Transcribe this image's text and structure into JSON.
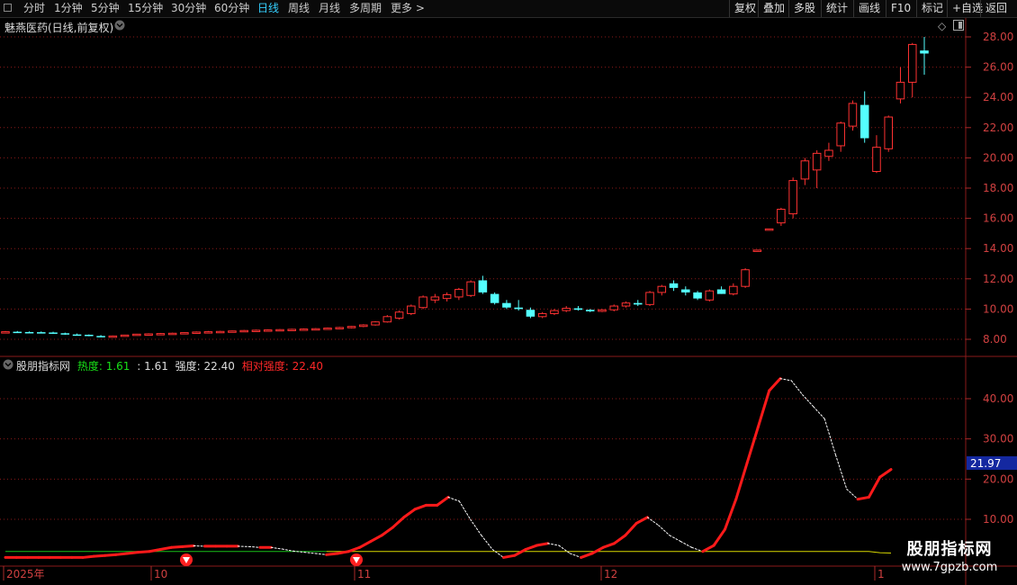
{
  "toolbar": {
    "left_items": [
      {
        "label": "分时",
        "active": false
      },
      {
        "label": "1分钟",
        "active": false
      },
      {
        "label": "5分钟",
        "active": false
      },
      {
        "label": "15分钟",
        "active": false
      },
      {
        "label": "30分钟",
        "active": false
      },
      {
        "label": "60分钟",
        "active": false
      },
      {
        "label": "日线",
        "active": true
      },
      {
        "label": "周线",
        "active": false
      },
      {
        "label": "月线",
        "active": false
      },
      {
        "label": "多周期",
        "active": false
      },
      {
        "label": "更多 >",
        "active": false
      }
    ],
    "right_items": [
      "复权",
      "叠加",
      "多股",
      "统计",
      "画线",
      "F10",
      "标记",
      "+自选",
      "返回"
    ]
  },
  "main_chart": {
    "title": "魅燕医药(日线,前复权)",
    "axis_ticks": [
      "28.00",
      "26.00",
      "24.00",
      "22.00",
      "20.00",
      "18.00",
      "16.00",
      "14.00",
      "12.00",
      "10.00",
      "8.00"
    ]
  },
  "indicator": {
    "name": "股朋指标网",
    "heat_label": "热度:",
    "heat_value": "1.61",
    "sep_value": ": 1.61",
    "strength_label": "强度:",
    "strength_value": "22.40",
    "rel_strength_label": "相对强度:",
    "rel_strength_value": "22.40",
    "axis_ticks": [
      "40.00",
      "30.00",
      "20.00",
      "10.00"
    ],
    "current_value": "21.97"
  },
  "date_axis": [
    "2025年",
    "10",
    "11",
    "12",
    "1"
  ],
  "watermark": {
    "name": "股朋指标网",
    "url": "www.7gpzb.com"
  },
  "colors": {
    "up": "#ff3232",
    "down": "#54ffff",
    "line_red": "#ff1a1a",
    "line_white": "#ffffff",
    "line_green": "#18c018",
    "line_yellow": "#d8d800",
    "grid": "#8a1a1a",
    "active_tab": "#35d0ff"
  },
  "chart_data": [
    {
      "type": "candlestick",
      "title": "魅燕医药(日线,前复权)",
      "ylim": [
        7,
        29
      ],
      "series": [
        {
          "name": "candles",
          "ohlc": [
            [
              8.5,
              8.55,
              8.45,
              8.5
            ],
            [
              8.5,
              8.55,
              8.45,
              8.48
            ],
            [
              8.48,
              8.52,
              8.44,
              8.47
            ],
            [
              8.47,
              8.52,
              8.42,
              8.45
            ],
            [
              8.45,
              8.5,
              8.38,
              8.4
            ],
            [
              8.4,
              8.44,
              8.3,
              8.32
            ],
            [
              8.32,
              8.38,
              8.25,
              8.3
            ],
            [
              8.3,
              8.32,
              8.2,
              8.22
            ],
            [
              8.22,
              8.28,
              8.16,
              8.18
            ],
            [
              8.18,
              8.25,
              8.15,
              8.22
            ],
            [
              8.22,
              8.3,
              8.2,
              8.28
            ],
            [
              8.28,
              8.36,
              8.24,
              8.34
            ],
            [
              8.34,
              8.4,
              8.28,
              8.36
            ],
            [
              8.36,
              8.42,
              8.3,
              8.38
            ],
            [
              8.38,
              8.44,
              8.32,
              8.4
            ],
            [
              8.4,
              8.46,
              8.36,
              8.44
            ],
            [
              8.44,
              8.52,
              8.4,
              8.48
            ],
            [
              8.48,
              8.55,
              8.42,
              8.5
            ],
            [
              8.5,
              8.56,
              8.44,
              8.52
            ],
            [
              8.52,
              8.58,
              8.46,
              8.55
            ],
            [
              8.55,
              8.62,
              8.5,
              8.58
            ],
            [
              8.58,
              8.64,
              8.52,
              8.6
            ],
            [
              8.6,
              8.66,
              8.54,
              8.62
            ],
            [
              8.62,
              8.68,
              8.56,
              8.64
            ],
            [
              8.64,
              8.7,
              8.58,
              8.66
            ],
            [
              8.66,
              8.72,
              8.6,
              8.68
            ],
            [
              8.68,
              8.74,
              8.62,
              8.7
            ],
            [
              8.7,
              8.78,
              8.64,
              8.74
            ],
            [
              8.74,
              8.82,
              8.68,
              8.78
            ],
            [
              8.78,
              8.88,
              8.72,
              8.85
            ],
            [
              8.85,
              9.0,
              8.8,
              8.95
            ],
            [
              8.95,
              9.2,
              8.9,
              9.15
            ],
            [
              9.15,
              9.6,
              9.1,
              9.5
            ],
            [
              9.4,
              9.9,
              9.3,
              9.8
            ],
            [
              9.7,
              10.3,
              9.6,
              10.2
            ],
            [
              10.1,
              10.9,
              10.0,
              10.8
            ],
            [
              10.6,
              11.0,
              10.4,
              10.8
            ],
            [
              10.7,
              11.1,
              10.5,
              10.95
            ],
            [
              10.8,
              11.4,
              10.6,
              11.3
            ],
            [
              10.9,
              11.9,
              10.8,
              11.8
            ],
            [
              11.9,
              12.2,
              11.0,
              11.1
            ],
            [
              11.0,
              11.1,
              10.3,
              10.4
            ],
            [
              10.4,
              10.6,
              10.0,
              10.1
            ],
            [
              10.1,
              10.6,
              9.9,
              10.0
            ],
            [
              9.95,
              10.1,
              9.4,
              9.5
            ],
            [
              9.5,
              9.8,
              9.4,
              9.7
            ],
            [
              9.7,
              10.0,
              9.6,
              9.9
            ],
            [
              9.9,
              10.2,
              9.8,
              10.05
            ],
            [
              10.05,
              10.2,
              9.9,
              9.95
            ],
            [
              9.95,
              10.0,
              9.8,
              9.85
            ],
            [
              9.85,
              10.0,
              9.8,
              9.95
            ],
            [
              9.95,
              10.3,
              9.85,
              10.2
            ],
            [
              10.2,
              10.5,
              10.1,
              10.4
            ],
            [
              10.4,
              10.6,
              10.2,
              10.3
            ],
            [
              10.3,
              11.2,
              10.2,
              11.1
            ],
            [
              11.1,
              11.6,
              10.9,
              11.5
            ],
            [
              11.7,
              11.9,
              11.2,
              11.4
            ],
            [
              11.3,
              11.5,
              10.9,
              11.1
            ],
            [
              11.1,
              11.2,
              10.6,
              10.7
            ],
            [
              10.6,
              11.3,
              10.5,
              11.2
            ],
            [
              11.3,
              11.5,
              11.0,
              11.0
            ],
            [
              11.0,
              11.7,
              10.9,
              11.5
            ],
            [
              11.5,
              12.7,
              11.4,
              12.6
            ],
            [
              13.9,
              13.9,
              13.9,
              13.9
            ],
            [
              15.3,
              15.3,
              15.3,
              15.3
            ],
            [
              15.7,
              16.7,
              15.5,
              16.6
            ],
            [
              16.3,
              18.7,
              16.0,
              18.5
            ],
            [
              18.6,
              20.0,
              18.2,
              19.8
            ],
            [
              19.2,
              20.5,
              18.0,
              20.3
            ],
            [
              20.1,
              21.0,
              19.8,
              20.5
            ],
            [
              20.8,
              22.4,
              20.4,
              22.3
            ],
            [
              22.1,
              23.8,
              21.8,
              23.6
            ],
            [
              23.5,
              24.4,
              21.0,
              21.3
            ],
            [
              19.1,
              21.5,
              19.0,
              20.7
            ],
            [
              20.6,
              22.8,
              20.4,
              22.7
            ],
            [
              23.9,
              26.0,
              23.6,
              25.0
            ],
            [
              25.0,
              27.6,
              24.0,
              27.5
            ],
            [
              27.1,
              28.0,
              25.5,
              26.9
            ]
          ]
        }
      ]
    },
    {
      "type": "line",
      "title": "股朋指标网",
      "ylim": [
        0,
        49
      ],
      "series": [
        {
          "name": "强度",
          "values": [
            0.5,
            0.5,
            0.5,
            0.5,
            0.5,
            0.5,
            0.5,
            0.5,
            0.8,
            1.0,
            1.2,
            1.5,
            1.8,
            2.0,
            2.5,
            3.0,
            3.2,
            3.4,
            3.3,
            3.3,
            3.3,
            3.3,
            3.2,
            3.0,
            3.0,
            2.6,
            2.1,
            1.8,
            1.5,
            1.2,
            1.5,
            2.0,
            3.0,
            4.5,
            6.0,
            8.0,
            10.5,
            12.5,
            13.5,
            13.5,
            15.5,
            14.5,
            10.0,
            6.0,
            2.5,
            0.5,
            1.0,
            2.5,
            3.5,
            4.0,
            3.5,
            1.5,
            0.5,
            1.5,
            3.0,
            4.0,
            6.0,
            9.0,
            10.5,
            8.5,
            6.0,
            4.5,
            3.0,
            2.0,
            3.5,
            7.5,
            15.0,
            24.0,
            33.0,
            42.0,
            45.0,
            44.5,
            41.0,
            38.0,
            35.0,
            26.0,
            17.5,
            15.0,
            15.5,
            20.5,
            22.4
          ]
        },
        {
          "name": "热度",
          "values": [
            2.0,
            2.0,
            2.0,
            2.0,
            2.0,
            2.0,
            2.0,
            2.0,
            2.0,
            2.0,
            2.0,
            2.0,
            2.0,
            2.0,
            2.0,
            2.0,
            2.0,
            2.0,
            2.0,
            2.0,
            2.0,
            2.0,
            2.0,
            2.0,
            2.0,
            2.0,
            2.0,
            2.0,
            2.0,
            2.0,
            2.0,
            2.0,
            2.0,
            2.0,
            2.0,
            2.0,
            2.0,
            2.0,
            2.0,
            2.0,
            2.0,
            2.0,
            2.0,
            2.0,
            2.0,
            2.0,
            2.0,
            2.0,
            2.0,
            2.0,
            2.0,
            2.0,
            2.0,
            2.0,
            2.0,
            2.0,
            2.0,
            2.0,
            2.0,
            2.0,
            2.0,
            2.0,
            2.0,
            2.0,
            2.0,
            2.0,
            2.0,
            2.0,
            2.0,
            2.0,
            2.0,
            2.0,
            2.0,
            2.0,
            2.0,
            2.0,
            2.0,
            2.0,
            2.0,
            1.7,
            1.61
          ]
        }
      ]
    }
  ]
}
